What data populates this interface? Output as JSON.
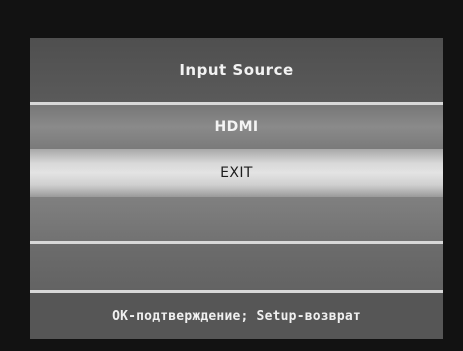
{
  "menu": {
    "title": "Input Source",
    "items": [
      {
        "label": "HDMI",
        "selected": false
      },
      {
        "label": "EXIT",
        "selected": true
      }
    ]
  },
  "footer": {
    "hint": "OK-подтверждение; Setup-возврат"
  },
  "colors": {
    "panel": "#5a5a5a",
    "highlight": "#e3e3e3",
    "divider": "#d8d8d8",
    "bezel": "#121212"
  }
}
